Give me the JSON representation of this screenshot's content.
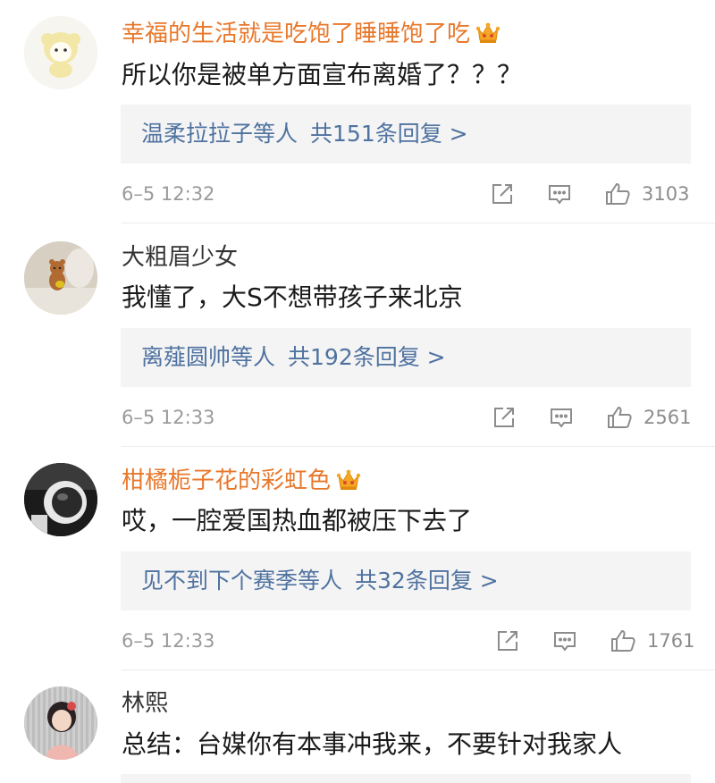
{
  "comments": [
    {
      "username": "幸福的生活就是吃饱了睡睡饱了吃",
      "vip": true,
      "text": "所以你是被单方面宣布离婚了？？？",
      "reply_users": "温柔拉拉子等人",
      "reply_count": "共151条回复 >",
      "time": "6–5 12:32",
      "likes": "3103"
    },
    {
      "username": "大粗眉少女",
      "vip": false,
      "text": "我懂了，大S不想带孩子来北京",
      "reply_users": "离薤圆帅等人",
      "reply_count": "共192条回复 >",
      "time": "6–5 12:33",
      "likes": "2561"
    },
    {
      "username": "柑橘栀子花的彩虹色",
      "vip": true,
      "text": "哎，一腔爱国热血都被压下去了",
      "reply_users": "见不到下个赛季等人",
      "reply_count": "共32条回复 >",
      "time": "6–5 12:33",
      "likes": "1761"
    },
    {
      "username": "林熙",
      "vip": false,
      "text": "总结：台媒你有本事冲我来，不要针对我家人"
    }
  ],
  "colors": {
    "vip_name": "#e8782b",
    "reply_link": "#4f72a0",
    "reply_bg": "#f4f4f4",
    "meta_gray": "#9a9a9a"
  },
  "icons": [
    "crown-vip-icon",
    "share-icon",
    "comment-icon",
    "like-icon"
  ]
}
